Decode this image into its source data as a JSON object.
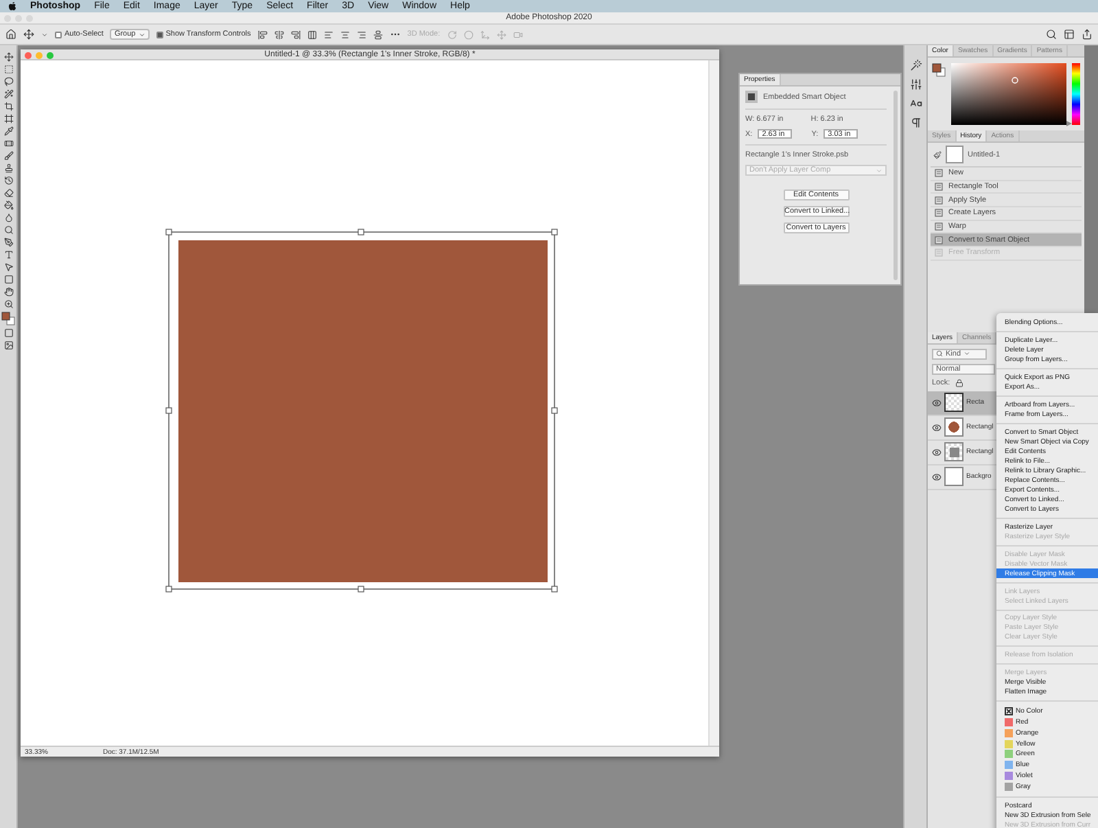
{
  "menu_bar": {
    "app": "Photoshop",
    "items": [
      "File",
      "Edit",
      "Image",
      "Layer",
      "Type",
      "Select",
      "Filter",
      "3D",
      "View",
      "Window",
      "Help"
    ]
  },
  "app_title": "Adobe Photoshop 2020",
  "options_bar": {
    "auto_select": {
      "label": "Auto-Select",
      "checked": false
    },
    "target": "Group",
    "show_transform": {
      "label": "Show Transform Controls",
      "checked": true
    },
    "mode_3d": "3D Mode:"
  },
  "document": {
    "title": "Untitled-1 @ 33.3% (Rectangle 1's Inner Stroke, RGB/8) *",
    "zoom": "33.33%",
    "doc_size": "Doc: 37.1M/12.5M"
  },
  "properties": {
    "title": "Properties",
    "type": "Embedded Smart Object",
    "w": "W: 6.677 in",
    "h": "H: 6.23 in",
    "x_label": "X:",
    "x": "2.63 in",
    "y_label": "Y:",
    "y": "3.03 in",
    "file": "Rectangle 1's Inner Stroke.psb",
    "layer_comp": "Don't Apply Layer Comp",
    "buttons": [
      "Edit Contents",
      "Convert to Linked...",
      "Convert to Layers"
    ]
  },
  "color_panel": {
    "hue": {
      "level": 0.02
    },
    "tabs": [
      {
        "label": "Color",
        "selected": true
      },
      {
        "label": "Swatches",
        "selected": false
      },
      {
        "label": "Gradients",
        "selected": false
      },
      {
        "label": "Patterns",
        "selected": false
      }
    ]
  },
  "history_panel": {
    "tabs": [
      {
        "label": "Styles",
        "selected": false
      },
      {
        "label": "History",
        "selected": true
      },
      {
        "label": "Actions",
        "selected": false
      }
    ],
    "snapshot": "Untitled-1",
    "states": [
      {
        "label": "New",
        "selected": false,
        "disabled": false
      },
      {
        "label": "Rectangle Tool",
        "selected": false,
        "disabled": false
      },
      {
        "label": "Apply Style",
        "selected": false,
        "disabled": false
      },
      {
        "label": "Create Layers",
        "selected": false,
        "disabled": false
      },
      {
        "label": "Warp",
        "selected": false,
        "disabled": false
      },
      {
        "label": "Convert to Smart Object",
        "selected": true,
        "disabled": false
      },
      {
        "label": "Free Transform",
        "selected": false,
        "disabled": true
      }
    ]
  },
  "layers_panel": {
    "tabs": [
      {
        "label": "Layers",
        "selected": true
      },
      {
        "label": "Channels",
        "selected": false
      }
    ],
    "filter": "Kind",
    "blend_mode": "Normal",
    "lock_label": "Lock:",
    "layers": [
      {
        "name": "Recta",
        "kind": "smart",
        "selected": true,
        "visible": true
      },
      {
        "name": "Rectangl",
        "kind": "fill",
        "selected": false,
        "visible": true
      },
      {
        "name": "Rectangl",
        "kind": "pattern",
        "selected": false,
        "visible": true
      },
      {
        "name": "Backgro",
        "kind": "white",
        "selected": false,
        "visible": true
      }
    ]
  },
  "context_menu": [
    {
      "kind": "item",
      "label": "Blending Options...",
      "disabled": false,
      "selected": false
    },
    {
      "kind": "separator"
    },
    {
      "kind": "item",
      "label": "Duplicate Layer...",
      "disabled": false,
      "selected": false
    },
    {
      "kind": "item",
      "label": "Delete Layer",
      "disabled": false,
      "selected": false
    },
    {
      "kind": "item",
      "label": "Group from Layers...",
      "disabled": false,
      "selected": false
    },
    {
      "kind": "separator"
    },
    {
      "kind": "item",
      "label": "Quick Export as PNG",
      "disabled": false,
      "selected": false
    },
    {
      "kind": "item",
      "label": "Export As...",
      "disabled": false,
      "selected": false
    },
    {
      "kind": "separator"
    },
    {
      "kind": "item",
      "label": "Artboard from Layers...",
      "disabled": false,
      "selected": false
    },
    {
      "kind": "item",
      "label": "Frame from Layers...",
      "disabled": false,
      "selected": false
    },
    {
      "kind": "separator"
    },
    {
      "kind": "item",
      "label": "Convert to Smart Object",
      "disabled": false,
      "selected": false
    },
    {
      "kind": "item",
      "label": "New Smart Object via Copy",
      "disabled": false,
      "selected": false
    },
    {
      "kind": "item",
      "label": "Edit Contents",
      "disabled": false,
      "selected": false
    },
    {
      "kind": "item",
      "label": "Relink to File...",
      "disabled": false,
      "selected": false
    },
    {
      "kind": "item",
      "label": "Relink to Library Graphic...",
      "disabled": false,
      "selected": false
    },
    {
      "kind": "item",
      "label": "Replace Contents...",
      "disabled": false,
      "selected": false
    },
    {
      "kind": "item",
      "label": "Export Contents...",
      "disabled": false,
      "selected": false
    },
    {
      "kind": "item",
      "label": "Convert to Linked...",
      "disabled": false,
      "selected": false
    },
    {
      "kind": "item",
      "label": "Convert to Layers",
      "disabled": false,
      "selected": false
    },
    {
      "kind": "separator"
    },
    {
      "kind": "item",
      "label": "Rasterize Layer",
      "disabled": false,
      "selected": false
    },
    {
      "kind": "item",
      "label": "Rasterize Layer Style",
      "disabled": true,
      "selected": false
    },
    {
      "kind": "separator"
    },
    {
      "kind": "item",
      "label": "Disable Layer Mask",
      "disabled": true,
      "selected": false
    },
    {
      "kind": "item",
      "label": "Disable Vector Mask",
      "disabled": true,
      "selected": false
    },
    {
      "kind": "item",
      "label": "Release Clipping Mask",
      "disabled": false,
      "selected": true
    },
    {
      "kind": "separator"
    },
    {
      "kind": "item",
      "label": "Link Layers",
      "disabled": true,
      "selected": false
    },
    {
      "kind": "item",
      "label": "Select Linked Layers",
      "disabled": true,
      "selected": false
    },
    {
      "kind": "separator"
    },
    {
      "kind": "item",
      "label": "Copy Layer Style",
      "disabled": true,
      "selected": false
    },
    {
      "kind": "item",
      "label": "Paste Layer Style",
      "disabled": true,
      "selected": false
    },
    {
      "kind": "item",
      "label": "Clear Layer Style",
      "disabled": true,
      "selected": false
    },
    {
      "kind": "separator"
    },
    {
      "kind": "item",
      "label": "Release from Isolation",
      "disabled": true,
      "selected": false
    },
    {
      "kind": "separator"
    },
    {
      "kind": "item",
      "label": "Merge Layers",
      "disabled": true,
      "selected": false
    },
    {
      "kind": "item",
      "label": "Merge Visible",
      "disabled": false,
      "selected": false
    },
    {
      "kind": "item",
      "label": "Flatten Image",
      "disabled": false,
      "selected": false
    },
    {
      "kind": "separator"
    },
    {
      "kind": "nocolor",
      "label": "No Color",
      "disabled": false,
      "selected": false
    },
    {
      "kind": "color",
      "label": "Red",
      "color": "#f06a6a",
      "disabled": false,
      "selected": false
    },
    {
      "kind": "color",
      "label": "Orange",
      "color": "#f5a15a",
      "disabled": false,
      "selected": false
    },
    {
      "kind": "color",
      "label": "Yellow",
      "color": "#e3d55c",
      "disabled": false,
      "selected": false
    },
    {
      "kind": "color",
      "label": "Green",
      "color": "#8ed07d",
      "disabled": false,
      "selected": false
    },
    {
      "kind": "color",
      "label": "Blue",
      "color": "#80b4ee",
      "disabled": false,
      "selected": false
    },
    {
      "kind": "color",
      "label": "Violet",
      "color": "#a88ade",
      "disabled": false,
      "selected": false
    },
    {
      "kind": "color",
      "label": "Gray",
      "color": "#a3a3a3",
      "disabled": false,
      "selected": false
    },
    {
      "kind": "separator"
    },
    {
      "kind": "item",
      "label": "Postcard",
      "disabled": false,
      "selected": false
    },
    {
      "kind": "item",
      "label": "New 3D Extrusion from Sele",
      "disabled": false,
      "selected": false
    },
    {
      "kind": "item",
      "label": "New 3D Extrusion from Curr",
      "disabled": true,
      "selected": false
    }
  ]
}
